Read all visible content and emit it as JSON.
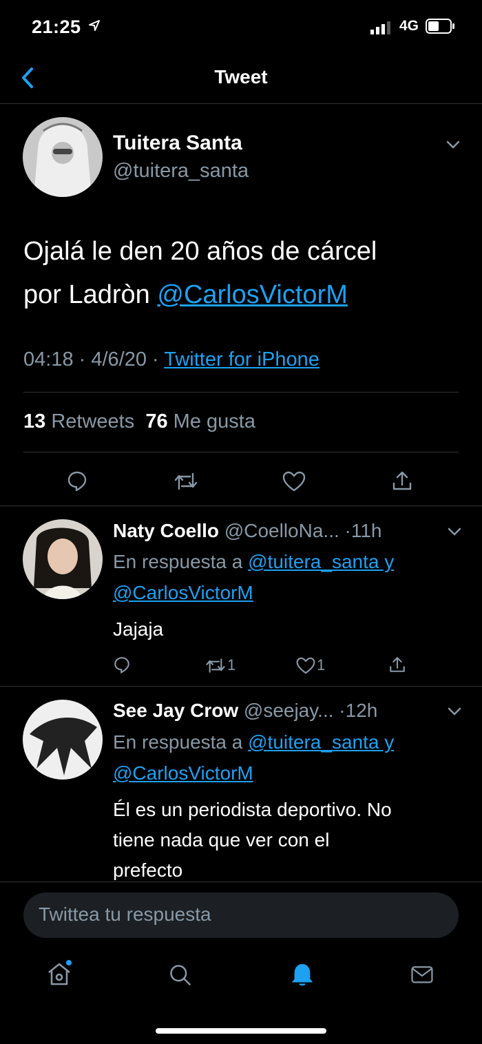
{
  "status": {
    "time": "21:25",
    "network": "4G"
  },
  "nav": {
    "title": "Tweet"
  },
  "tweet": {
    "author_name": "Tuitera Santa",
    "author_handle": "@tuitera_santa",
    "text_line1": "Ojalá le den 20 años de cárcel",
    "text_line2_prefix": "por Ladròn",
    "mention": "@CarlosVictorM",
    "time": "04:18",
    "date": "4/6/20",
    "source": "Twitter for iPhone",
    "retweet_count": "13",
    "retweet_label": "Retweets",
    "like_count": "76",
    "like_label": "Me gusta"
  },
  "replies": [
    {
      "name": "Naty Coello",
      "handle": "@CoelloNa...",
      "age": "11h",
      "reply_prefix": "En respuesta a",
      "reply_to_1": "@tuitera_santa y",
      "reply_to_2": "@CarlosVictorM",
      "text": "Jajaja",
      "retweets": "1",
      "likes": "1"
    },
    {
      "name": "See Jay Crow",
      "handle": "@seejay...",
      "age": "12h",
      "reply_prefix": "En respuesta a",
      "reply_to_1": "@tuitera_santa y",
      "reply_to_2": "@CarlosVictorM",
      "text_line1": "Él es un periodista deportivo. No",
      "text_line2": "tiene nada que ver con el",
      "text_line3": "prefecto"
    }
  ],
  "composer": {
    "placeholder": "Twittea tu respuesta"
  },
  "tabs": [
    "home-icon",
    "search-icon",
    "notifications-icon",
    "messages-icon"
  ],
  "colors": {
    "accent": "#1da1f2",
    "muted": "#8899a6",
    "background": "#000000",
    "divider": "#2f3336"
  }
}
